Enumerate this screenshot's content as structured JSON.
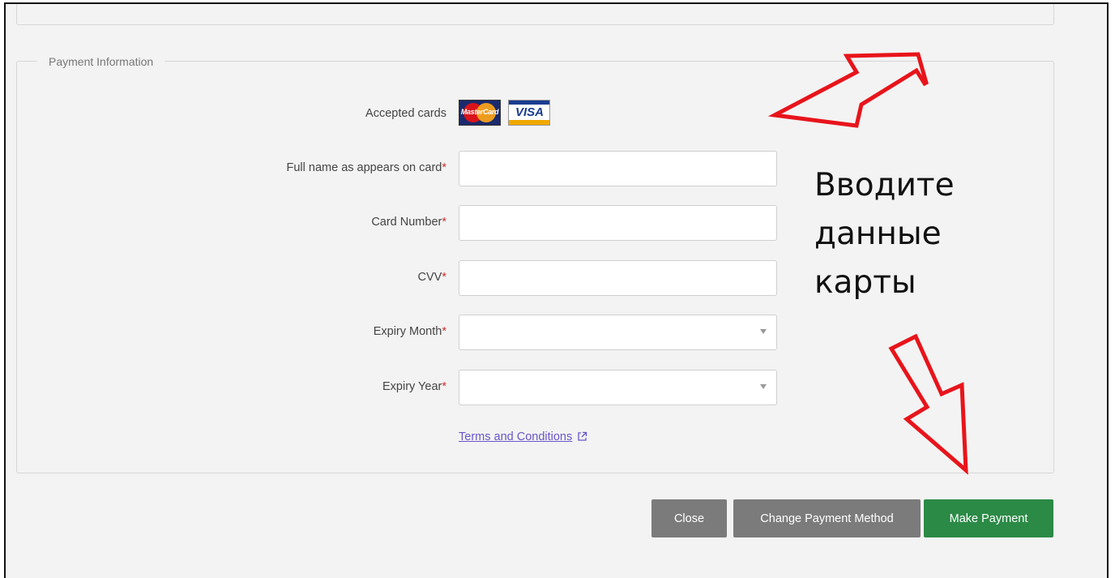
{
  "payment": {
    "legend": "Payment Information",
    "accepted_cards_label": "Accepted cards",
    "cards": [
      {
        "name": "MasterCard",
        "label": "MasterCard"
      },
      {
        "name": "Visa",
        "label": "VISA"
      }
    ],
    "fields": {
      "full_name": {
        "label": "Full name as appears on card",
        "value": ""
      },
      "card_number": {
        "label": "Card Number",
        "value": ""
      },
      "cvv": {
        "label": "CVV",
        "value": ""
      },
      "expiry_month": {
        "label": "Expiry Month",
        "value": ""
      },
      "expiry_year": {
        "label": "Expiry Year",
        "value": ""
      }
    },
    "required_marker": "*",
    "terms_link": "Terms and Conditions"
  },
  "buttons": {
    "close": "Close",
    "change_method": "Change Payment Method",
    "make_payment": "Make Payment"
  },
  "annotation": {
    "line1": "Вводите",
    "line2": "данные",
    "line3": "карты",
    "arrow_color": "#e8141b"
  },
  "colors": {
    "panel_bg": "#f3f3f3",
    "button_grey": "#7b7b7b",
    "button_green": "#2b8a46",
    "required": "#c9302c",
    "link": "#6a55c8"
  }
}
